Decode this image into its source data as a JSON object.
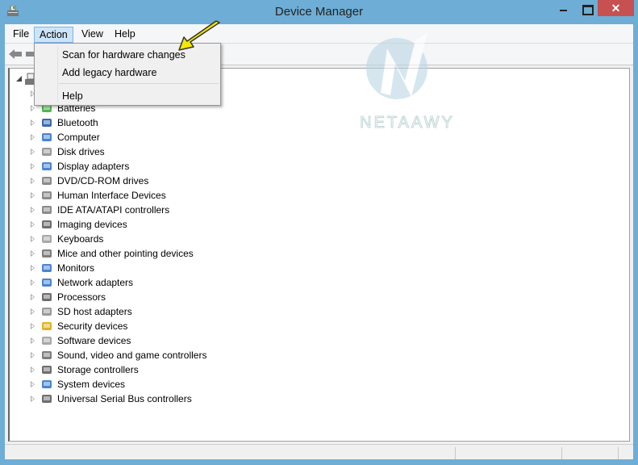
{
  "window": {
    "title": "Device Manager",
    "close_glyph": "✕"
  },
  "menubar": [
    "File",
    "Action",
    "View",
    "Help"
  ],
  "action_menu": {
    "items": [
      "Scan for hardware changes",
      "Add legacy hardware",
      "Help"
    ]
  },
  "tree": {
    "items": [
      {
        "label": "Batteries",
        "icon": "battery-icon"
      },
      {
        "label": "Bluetooth",
        "icon": "bluetooth-icon"
      },
      {
        "label": "Computer",
        "icon": "computer-icon"
      },
      {
        "label": "Disk drives",
        "icon": "disk-drive-icon"
      },
      {
        "label": "Display adapters",
        "icon": "display-adapter-icon"
      },
      {
        "label": "DVD/CD-ROM drives",
        "icon": "dvd-drive-icon"
      },
      {
        "label": "Human Interface Devices",
        "icon": "hid-icon"
      },
      {
        "label": "IDE ATA/ATAPI controllers",
        "icon": "ide-controller-icon"
      },
      {
        "label": "Imaging devices",
        "icon": "camera-icon"
      },
      {
        "label": "Keyboards",
        "icon": "keyboard-icon"
      },
      {
        "label": "Mice and other pointing devices",
        "icon": "mouse-icon"
      },
      {
        "label": "Monitors",
        "icon": "monitor-icon"
      },
      {
        "label": "Network adapters",
        "icon": "network-adapter-icon"
      },
      {
        "label": "Processors",
        "icon": "processor-icon"
      },
      {
        "label": "SD host adapters",
        "icon": "sd-host-icon"
      },
      {
        "label": "Security devices",
        "icon": "security-key-icon"
      },
      {
        "label": "Software devices",
        "icon": "software-device-icon"
      },
      {
        "label": "Sound, video and game controllers",
        "icon": "speaker-icon"
      },
      {
        "label": "Storage controllers",
        "icon": "storage-controller-icon"
      },
      {
        "label": "System devices",
        "icon": "system-device-icon"
      },
      {
        "label": "Universal Serial Bus controllers",
        "icon": "usb-icon"
      }
    ]
  },
  "watermark": {
    "text": "NETAAWY"
  },
  "colors": {
    "frame": "#6eadd5",
    "close": "#c75050",
    "menu_highlight": "#cce4f7",
    "arrow": "#f5e800"
  }
}
